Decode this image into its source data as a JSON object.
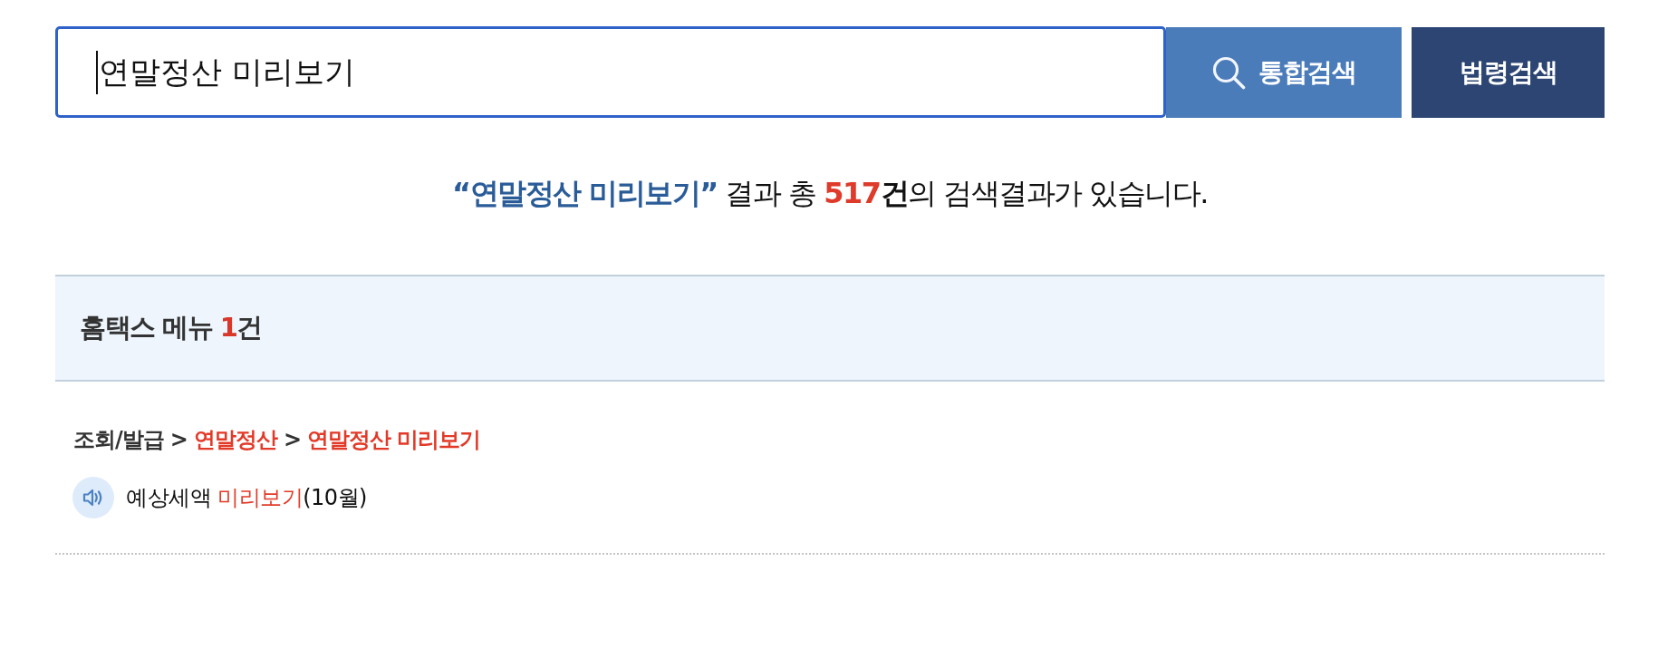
{
  "search": {
    "value": "연말정산 미리보기",
    "focused": true,
    "buttons": [
      {
        "label": "통합검색",
        "kind": "primary"
      },
      {
        "label": "법령검색",
        "kind": "secondary"
      }
    ]
  },
  "result_summary": [
    {
      "text": "“연말정산 미리보기”",
      "kind": "query"
    },
    {
      "text": " 결과 총 ",
      "kind": "plain"
    },
    {
      "text": "517",
      "kind": "count"
    },
    {
      "text": "건",
      "kind": "bold"
    },
    {
      "text": "의 검색결과가 있습니다.",
      "kind": "plain"
    }
  ],
  "menu_section": {
    "title": [
      {
        "text": "홈택스 메뉴 ",
        "kind": "plain"
      },
      {
        "text": "1",
        "kind": "count"
      },
      {
        "text": "건",
        "kind": "plain"
      }
    ],
    "results": [
      {
        "breadcrumb": [
          {
            "label": "조회/발급",
            "highlighted": false
          },
          {
            "separator": ">",
            "label": "연말정산",
            "highlighted": true
          },
          {
            "separator": ">",
            "label": "연말정산 미리보기",
            "highlighted": true
          }
        ],
        "links": [
          {
            "kind": "audio",
            "segments": [
              {
                "text": "예상세액 ",
                "highlighted": false
              },
              {
                "text": "미리보기",
                "highlighted": true
              },
              {
                "text": "(10월)",
                "highlighted": false
              }
            ]
          }
        ]
      }
    ]
  }
}
